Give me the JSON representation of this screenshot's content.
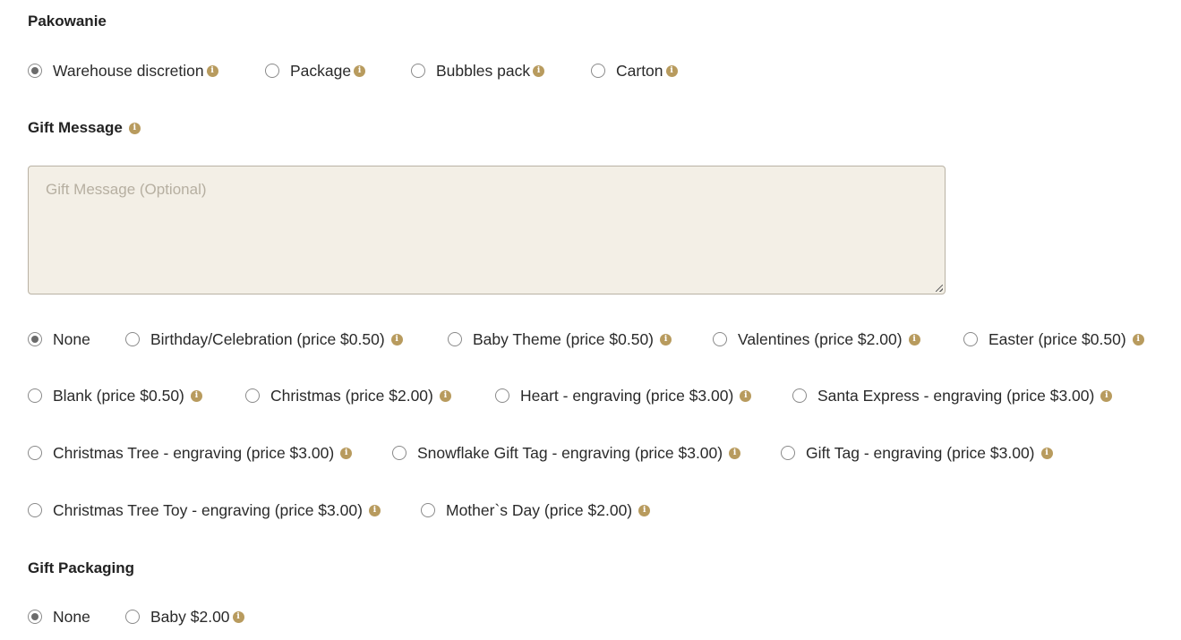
{
  "colors": {
    "accent": "#b89b5e",
    "textarea_bg": "#f3efe6",
    "radio_checked": "#6b6b6b"
  },
  "packing": {
    "title": "Pakowanie",
    "options": [
      {
        "label": "Warehouse discretion",
        "checked": true
      },
      {
        "label": "Package",
        "checked": false
      },
      {
        "label": "Bubbles pack",
        "checked": false
      },
      {
        "label": "Carton",
        "checked": false
      }
    ]
  },
  "gift_message": {
    "title": "Gift Message",
    "placeholder": "Gift Message (Optional)",
    "options": [
      {
        "label": "None",
        "checked": true
      },
      {
        "label": "Birthday/Celebration (price $0.50)",
        "checked": false
      },
      {
        "label": "Baby Theme (price $0.50)",
        "checked": false
      },
      {
        "label": "Valentines (price $2.00)",
        "checked": false
      },
      {
        "label": "Easter (price $0.50)",
        "checked": false
      },
      {
        "label": "Blank (price $0.50)",
        "checked": false
      },
      {
        "label": "Christmas (price $2.00)",
        "checked": false
      },
      {
        "label": "Heart - engraving (price $3.00)",
        "checked": false
      },
      {
        "label": "Santa Express - engraving (price $3.00)",
        "checked": false
      },
      {
        "label": "Christmas Tree - engraving (price $3.00)",
        "checked": false
      },
      {
        "label": "Snowflake Gift Tag - engraving (price $3.00)",
        "checked": false
      },
      {
        "label": "Gift Tag - engraving (price $3.00)",
        "checked": false
      },
      {
        "label": "Christmas Tree Toy - engraving (price $3.00)",
        "checked": false
      },
      {
        "label": "Mother`s Day (price $2.00)",
        "checked": false
      }
    ]
  },
  "gift_packaging": {
    "title": "Gift Packaging",
    "options": [
      {
        "label": "None",
        "checked": true
      },
      {
        "label": "Baby $2.00",
        "checked": false
      }
    ]
  },
  "icons": {
    "info": "info-icon",
    "radio": "radio-button",
    "resize": "resize-grip-icon"
  }
}
